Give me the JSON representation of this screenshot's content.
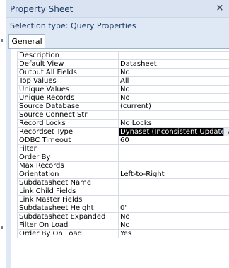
{
  "window": {
    "title": "Property Sheet",
    "close_glyph": "×"
  },
  "selection": {
    "text": "Selection type:  Query Properties"
  },
  "tabs": [
    {
      "label": "General"
    }
  ],
  "properties": [
    {
      "label": "Description",
      "value": ""
    },
    {
      "label": "Default View",
      "value": "Datasheet"
    },
    {
      "label": "Output All Fields",
      "value": "No"
    },
    {
      "label": "Top Values",
      "value": "All"
    },
    {
      "label": "Unique Values",
      "value": "No"
    },
    {
      "label": "Unique Records",
      "value": "No"
    },
    {
      "label": "Source Database",
      "value": "(current)"
    },
    {
      "label": "Source Connect Str",
      "value": ""
    },
    {
      "label": "Record Locks",
      "value": "No Locks"
    },
    {
      "label": "Recordset Type",
      "value": "Dynaset (Inconsistent Updates"
    },
    {
      "label": "ODBC Timeout",
      "value": "60"
    },
    {
      "label": "Filter",
      "value": ""
    },
    {
      "label": "Order By",
      "value": ""
    },
    {
      "label": "Max Records",
      "value": ""
    },
    {
      "label": "Orientation",
      "value": "Left-to-Right"
    },
    {
      "label": "Subdatasheet Name",
      "value": ""
    },
    {
      "label": "Link Child Fields",
      "value": ""
    },
    {
      "label": "Link Master Fields",
      "value": ""
    },
    {
      "label": "Subdatasheet Height",
      "value": "0\""
    },
    {
      "label": "Subdatasheet Expanded",
      "value": "No"
    },
    {
      "label": "Filter On Load",
      "value": "No"
    },
    {
      "label": "Order By On Load",
      "value": "Yes"
    }
  ],
  "selected_row": "Recordset Type",
  "icons": {
    "dropdown": "chevron-down-icon",
    "close": "close-icon"
  },
  "colors": {
    "panel_bg": "#dfe8f5",
    "title_text": "#1e3a66",
    "selected_bg": "#000000"
  }
}
